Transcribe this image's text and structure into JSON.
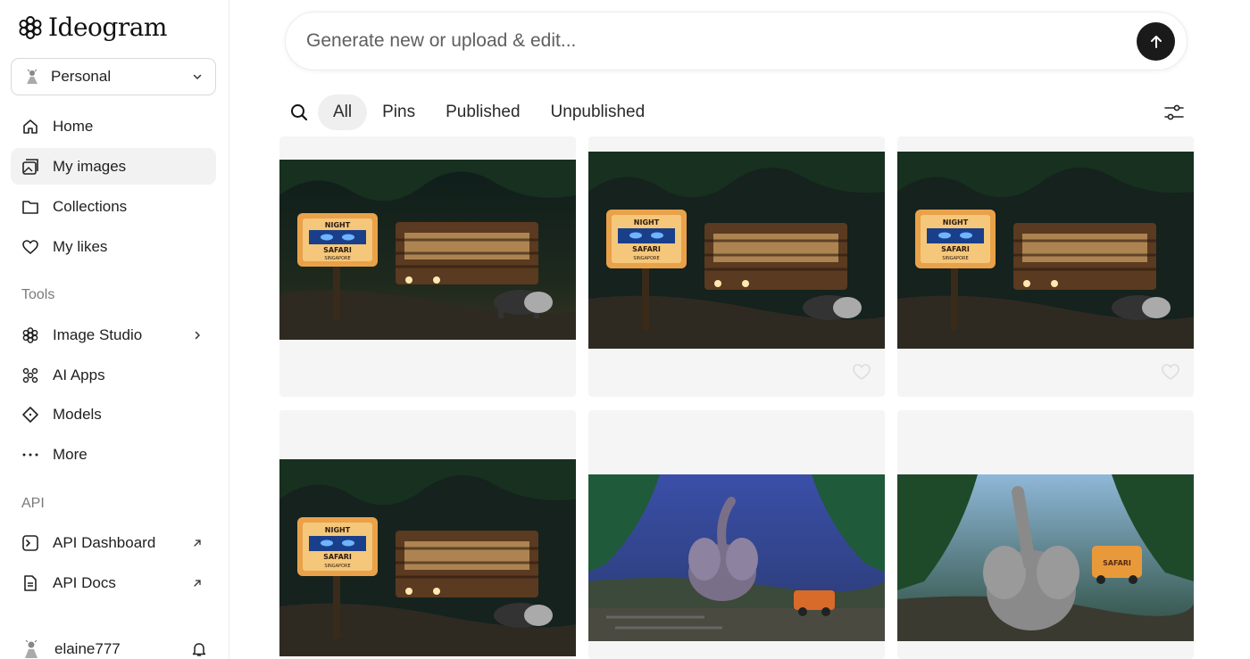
{
  "app": {
    "logo_text": "Ideogram"
  },
  "workspace": {
    "label": "Personal"
  },
  "nav": {
    "home": "Home",
    "my_images": "My images",
    "collections": "Collections",
    "my_likes": "My likes"
  },
  "tools": {
    "section": "Tools",
    "image_studio": "Image Studio",
    "ai_apps": "AI Apps",
    "models": "Models",
    "more": "More"
  },
  "api": {
    "section": "API",
    "dashboard": "API Dashboard",
    "docs": "API Docs"
  },
  "user": {
    "name": "elaine777"
  },
  "prompt": {
    "placeholder": "Generate new or upload & edit..."
  },
  "filters": {
    "tabs": [
      "All",
      "Pins",
      "Published",
      "Unpublished"
    ],
    "active": "All"
  },
  "images": [
    {
      "subject": "night-safari-tram-sign",
      "sign_line1": "NIGHT",
      "sign_line2": "SAFARI",
      "sign_line3": "SINGAPORE"
    },
    {
      "subject": "night-safari-tram-sign",
      "sign_line1": "NIGHT",
      "sign_line2": "SAFARI",
      "sign_line3": "SINGAPORE"
    },
    {
      "subject": "night-safari-tram-sign",
      "sign_line1": "NIGHT",
      "sign_line2": "SAFARI",
      "sign_line3": "SINGAPORE"
    },
    {
      "subject": "night-safari-tram-sign",
      "sign_line1": "NIGHT",
      "sign_line2": "SAFARI",
      "sign_line3": "SINGAPORE"
    },
    {
      "subject": "cartoon-elephant-jungle"
    },
    {
      "subject": "cartoon-elephant-safari-truck",
      "truck_text": "SAFARI"
    }
  ],
  "colors": {
    "accent": "#1a1a1a",
    "active_bg": "#f2f2f2",
    "card_bg": "#f5f5f5"
  }
}
